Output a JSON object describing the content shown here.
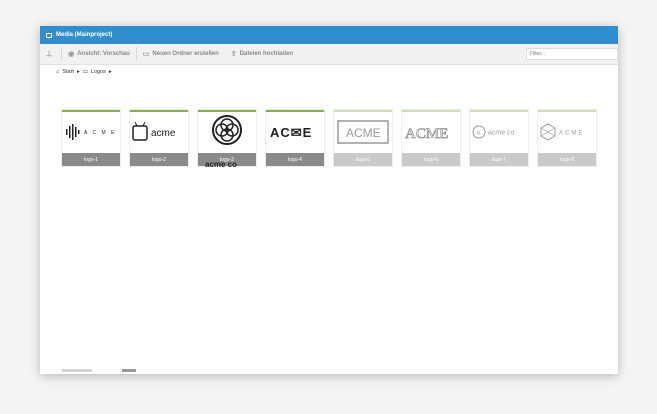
{
  "titlebar": {
    "title": "Media (Mainproject)"
  },
  "toolbar": {
    "view_label": "Ansicht: Vorschau",
    "new_folder_label": "Neuen Ordner erstellen",
    "upload_label": "Dateien hochladen",
    "filter_placeholder": "Filter..."
  },
  "breadcrumb": {
    "home": "Start",
    "sep1": "▸",
    "folder": "Logos",
    "sep2": "▸"
  },
  "tiles": [
    {
      "label": "logo-1"
    },
    {
      "label": "logo-2",
      "logo_text": "acme"
    },
    {
      "label": "logo-3",
      "logo_text": "acme co"
    },
    {
      "label": "logo-4",
      "logo_text": "AC✉E"
    },
    {
      "label": "logo-5",
      "logo_text": "ACME"
    },
    {
      "label": "logo-6",
      "logo_text": "ACME"
    },
    {
      "label": "logo-7",
      "logo_text": "acme co"
    },
    {
      "label": "logo-8",
      "logo_text": "ACME"
    }
  ],
  "colors": {
    "titlebar": "#2f8ecf",
    "accent_bar": "#7fb33a"
  }
}
